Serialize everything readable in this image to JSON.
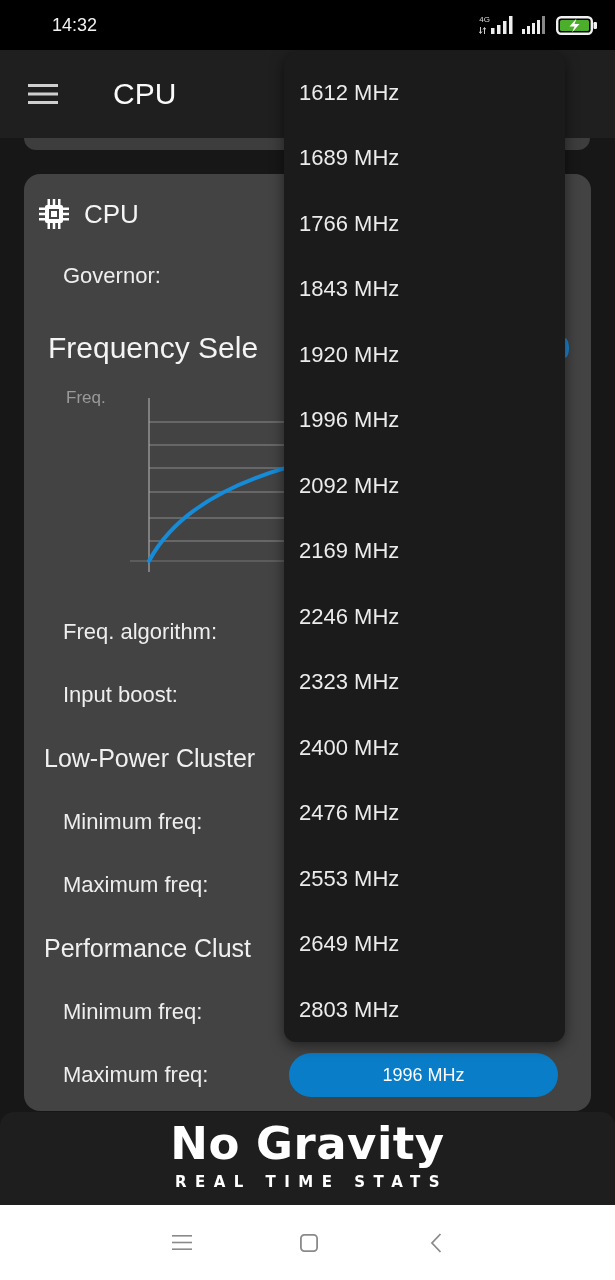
{
  "status_bar": {
    "time": "14:32",
    "network": "4G"
  },
  "app_bar": {
    "title": "CPU"
  },
  "card": {
    "title": "CPU",
    "rows": [
      {
        "kind": "setting",
        "label": "Governor:"
      },
      {
        "kind": "section",
        "label": "Frequency Sele",
        "trailing_icon": true
      },
      {
        "kind": "chart",
        "axis_label": "Freq."
      },
      {
        "kind": "setting",
        "label": "Freq. algorithm:"
      },
      {
        "kind": "setting",
        "label": "Input boost:"
      },
      {
        "kind": "group",
        "label": "Low-Power Cluster"
      },
      {
        "kind": "setting",
        "label": "Minimum freq:"
      },
      {
        "kind": "setting",
        "label": "Maximum freq:"
      },
      {
        "kind": "group",
        "label": "Performance Clust"
      },
      {
        "kind": "setting",
        "label": "Minimum freq:"
      },
      {
        "kind": "setting",
        "label": "Maximum freq:",
        "value": "1996 MHz"
      }
    ]
  },
  "dropdown": {
    "items": [
      {
        "label": "1612 MHz",
        "selected": false
      },
      {
        "label": "1689 MHz",
        "selected": false
      },
      {
        "label": "1766 MHz",
        "selected": false
      },
      {
        "label": "1843 MHz",
        "selected": false
      },
      {
        "label": "1920 MHz",
        "selected": false
      },
      {
        "label": "1996 MHz",
        "selected": false
      },
      {
        "label": "2092 MHz",
        "selected": false
      },
      {
        "label": "2169 MHz",
        "selected": false
      },
      {
        "label": "2246 MHz",
        "selected": false
      },
      {
        "label": "2323 MHz",
        "selected": false
      },
      {
        "label": "2400 MHz",
        "selected": false
      },
      {
        "label": "2476 MHz",
        "selected": false
      },
      {
        "label": "2553 MHz",
        "selected": false
      },
      {
        "label": "2649 MHz",
        "selected": false
      },
      {
        "label": "2803 MHz",
        "selected": false
      }
    ]
  },
  "banner": {
    "logo": "No Gravity",
    "tagline": "REAL TIME STATS"
  }
}
